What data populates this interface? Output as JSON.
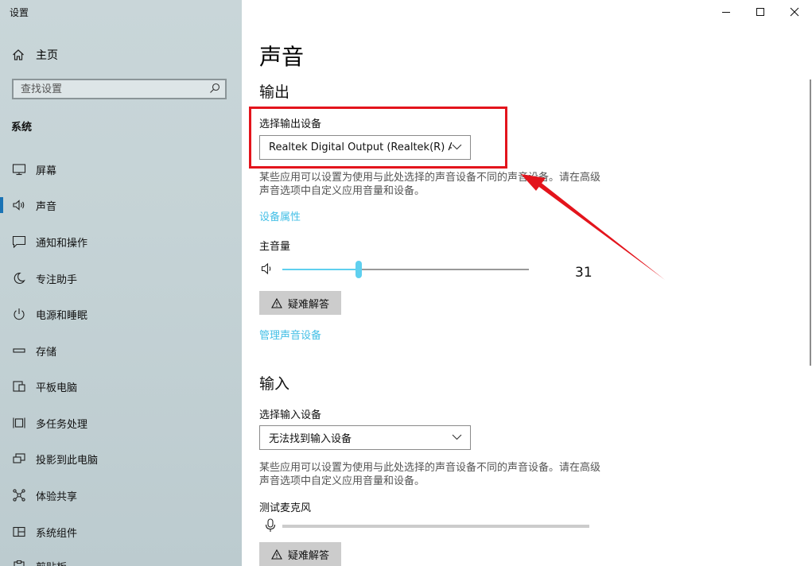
{
  "app": {
    "title": "设置"
  },
  "window": {
    "minimize": "minimize",
    "maximize": "maximize",
    "close": "close"
  },
  "sidebar": {
    "home": {
      "label": "主页",
      "icon": "home-icon"
    },
    "search": {
      "placeholder": "查找设置",
      "icon": "search-icon"
    },
    "section": "系统",
    "active_item": "sound",
    "items": [
      {
        "label": "屏幕",
        "icon": "monitor-icon"
      },
      {
        "label": "声音",
        "icon": "sound-icon"
      },
      {
        "label": "通知和操作",
        "icon": "notification-icon"
      },
      {
        "label": "专注助手",
        "icon": "moon-icon"
      },
      {
        "label": "电源和睡眠",
        "icon": "power-icon"
      },
      {
        "label": "存储",
        "icon": "storage-icon"
      },
      {
        "label": "平板电脑",
        "icon": "tablet-icon"
      },
      {
        "label": "多任务处理",
        "icon": "multitask-icon"
      },
      {
        "label": "投影到此电脑",
        "icon": "project-icon"
      },
      {
        "label": "体验共享",
        "icon": "share-icon"
      },
      {
        "label": "系统组件",
        "icon": "components-icon"
      },
      {
        "label": "剪贴板",
        "icon": "clipboard-icon"
      }
    ]
  },
  "main": {
    "title": "声音",
    "output": {
      "heading": "输出",
      "device_label": "选择输出设备",
      "device_value": "Realtek Digital Output (Realtek(R) A...",
      "description": "某些应用可以设置为使用与此处选择的声音设备不同的声音设备。请在高级声音选项中自定义应用音量和设备。",
      "properties_link": "设备属性",
      "volume_label": "主音量",
      "volume_value": "31",
      "volume_level": 31,
      "troubleshoot": "疑难解答",
      "manage_link": "管理声音设备"
    },
    "input": {
      "heading": "输入",
      "device_label": "选择输入设备",
      "device_value": "无法找到输入设备",
      "description": "某些应用可以设置为使用与此处选择的声音设备不同的声音设备。请在高级声音选项中自定义应用音量和设备。",
      "test_label": "测试麦克风",
      "mic_level": 0,
      "troubleshoot": "疑难解答"
    }
  },
  "colors": {
    "accent": "#43bfe6",
    "slider_thumb": "#5fd0ef",
    "highlight": "#e3141c"
  }
}
